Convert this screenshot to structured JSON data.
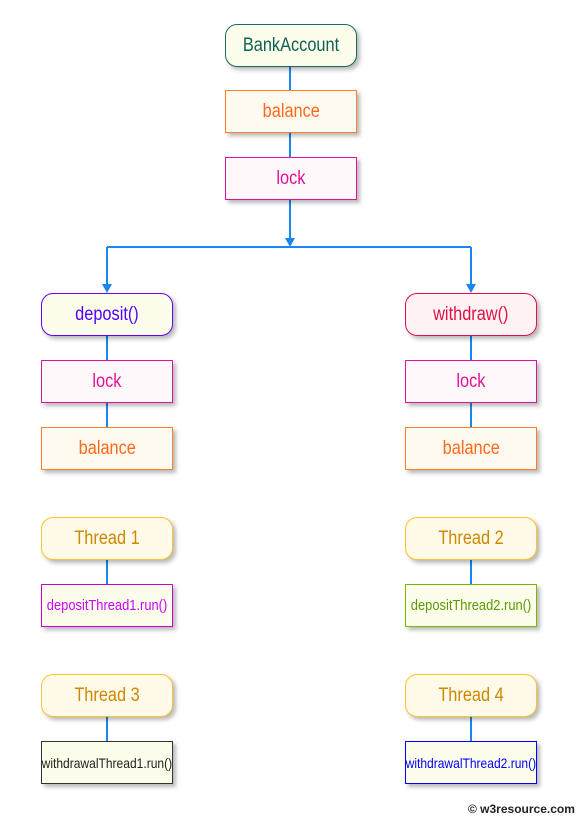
{
  "nodes": {
    "bank_account": "BankAccount",
    "balance": "balance",
    "lock": "lock",
    "deposit": "deposit()",
    "withdraw": "withdraw()",
    "deposit_lock": "lock",
    "deposit_balance": "balance",
    "withdraw_lock": "lock",
    "withdraw_balance": "balance",
    "thread1": "Thread 1",
    "thread2": "Thread 2",
    "thread3": "Thread 3",
    "thread4": "Thread 4",
    "deposit_thread1_run": "depositThread1.run()",
    "deposit_thread2_run": "depositThread2.run()",
    "withdrawal_thread1_run": "withdrawalThread1.run()",
    "withdrawal_thread2_run": "withdrawalThread2.run()"
  },
  "footer": "© w3resource.com",
  "colors": {
    "connector": "#1a86f0",
    "bank_account": "#0f5f55",
    "balance": "#ff6a1a",
    "lock": "#e0119a",
    "deposit": "#5500ff",
    "withdraw": "#e01048",
    "thread": "#cc8800",
    "deposit_thread1": "#cc00ff",
    "deposit_thread2": "#5a9a00",
    "withdrawal_thread1": "#222222",
    "withdrawal_thread2": "#0000ff"
  }
}
